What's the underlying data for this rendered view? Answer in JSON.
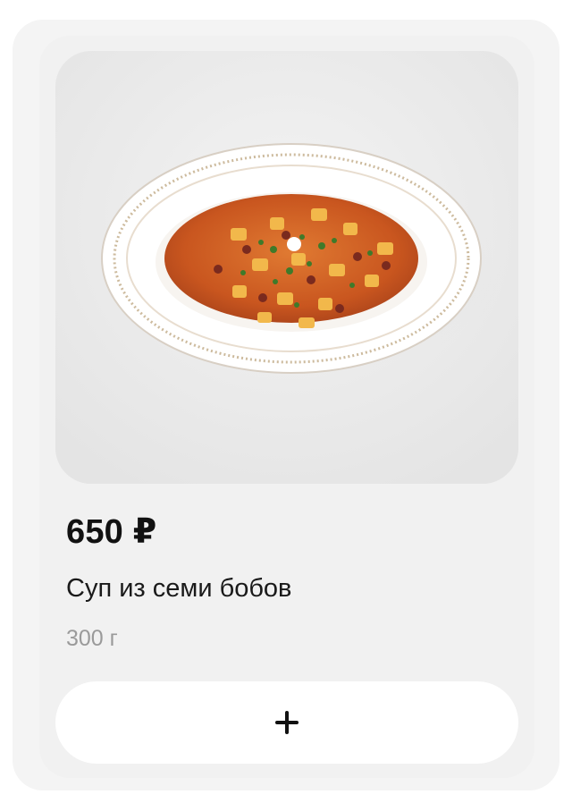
{
  "product": {
    "price": "650 ₽",
    "name": "Суп из семи бобов",
    "weight": "300 г",
    "image_icon": "soup-plate-photo"
  },
  "actions": {
    "add_icon": "plus-icon"
  },
  "colors": {
    "card_background": "#f1f1f1",
    "button_background": "#ffffff",
    "price_text": "#111111",
    "weight_text": "#9a9a9a"
  }
}
